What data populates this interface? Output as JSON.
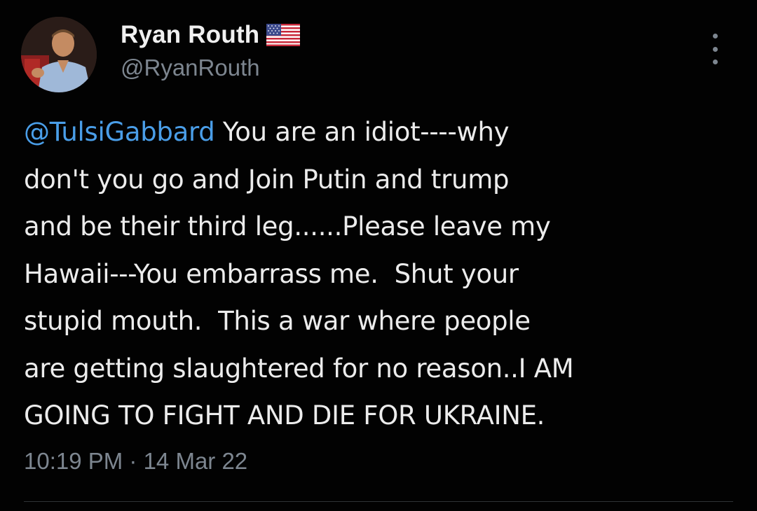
{
  "author": {
    "display_name": "Ryan Routh",
    "handle": "@RyanRouth",
    "badge_icon": "us-flag-emoji"
  },
  "tweet": {
    "mention": "@TulsiGabbard",
    "lines": [
      " You are an idiot----why",
      "don't you go and Join Putin and trump",
      "and be their third leg......Please leave my",
      "Hawaii---You embarrass me.  Shut your",
      "stupid mouth.  This a war where people",
      "are getting slaughtered for no reason..I AM",
      "GOING TO FIGHT AND DIE FOR UKRAINE."
    ],
    "timestamp": "10:19 PM · 14 Mar 22"
  },
  "colors": {
    "background": "#020202",
    "text": "#ececec",
    "mention": "#4a9ee8",
    "secondary": "#7d8690"
  },
  "icons": {
    "more": "more-vertical-icon"
  }
}
